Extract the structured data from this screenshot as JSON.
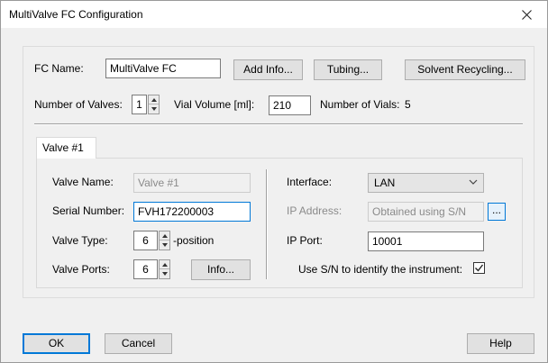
{
  "window": {
    "title": "MultiValve FC Configuration"
  },
  "fc": {
    "name_label": "FC Name:",
    "name_value": "MultiValve FC",
    "add_info_label": "Add Info...",
    "tubing_label": "Tubing...",
    "solvent_recycling_label": "Solvent Recycling...",
    "num_valves_label": "Number of Valves:",
    "num_valves_value": "1",
    "vial_volume_label": "Vial Volume [ml]:",
    "vial_volume_value": "210",
    "num_vials_label": "Number of Vials:",
    "num_vials_value": "5"
  },
  "tabs": [
    {
      "label": "Valve #1",
      "selected": true
    }
  ],
  "valve": {
    "name_label": "Valve Name:",
    "name_value": "Valve #1",
    "serial_label": "Serial Number:",
    "serial_value": "FVH172200003",
    "type_label": "Valve Type:",
    "type_value": "6",
    "type_suffix": "-position",
    "ports_label": "Valve Ports:",
    "ports_value": "6",
    "info_label": "Info...",
    "interface_label": "Interface:",
    "interface_value": "LAN",
    "ip_address_label": "IP Address:",
    "ip_address_value": "Obtained using S/N",
    "ip_browse_label": "...",
    "ip_port_label": "IP Port:",
    "ip_port_value": "10001",
    "use_sn_label": "Use S/N to identify the instrument:",
    "use_sn_checked": true
  },
  "footer": {
    "ok_label": "OK",
    "cancel_label": "Cancel",
    "help_label": "Help"
  },
  "icons": {
    "close": "close-icon",
    "spin_up": "spin-up-icon",
    "spin_down": "spin-down-icon",
    "dropdown": "chevron-down-icon",
    "check": "checkmark-icon"
  },
  "colors": {
    "focus_border": "#0078d7",
    "dialog_bg": "#f0f0f0",
    "title_bg": "#ffffff"
  }
}
